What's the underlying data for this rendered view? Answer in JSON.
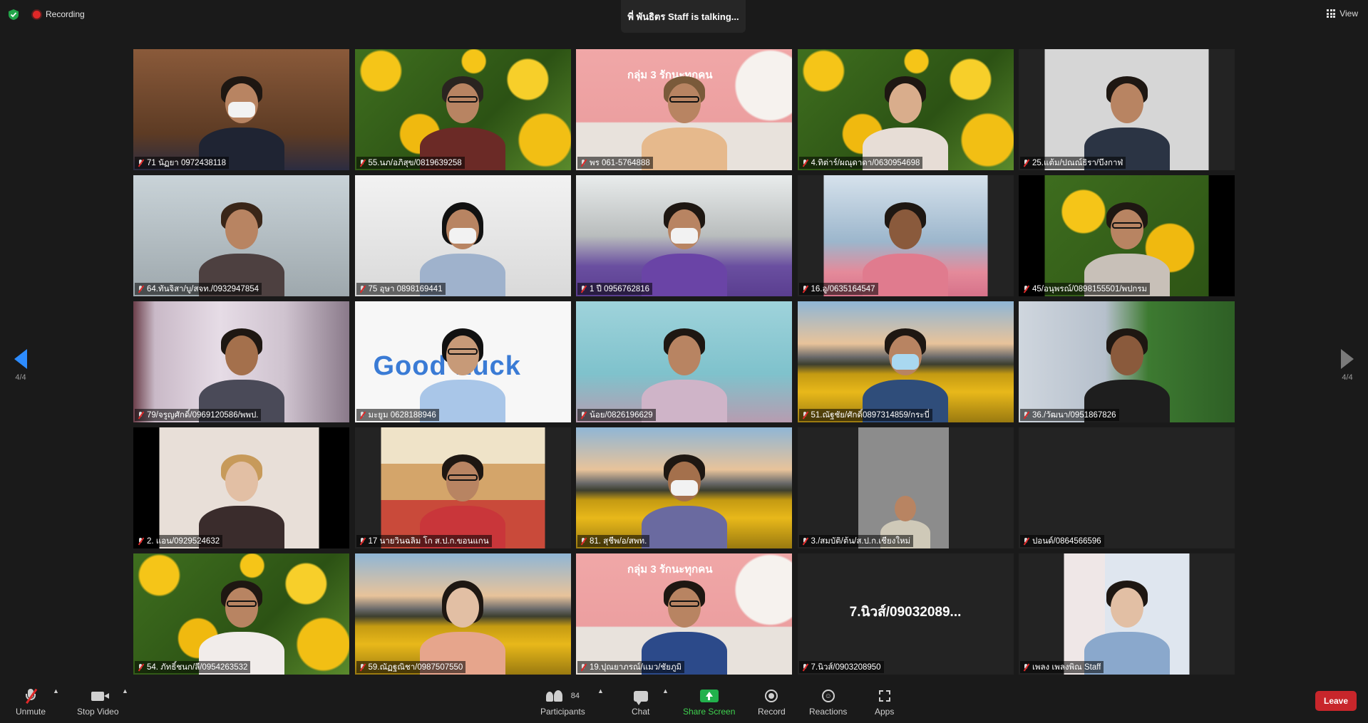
{
  "topbar": {
    "recording_label": "Recording",
    "talking_banner": "พี่ พันธิตร Staff is talking...",
    "view_label": "View"
  },
  "pager": {
    "page": "4/4"
  },
  "tiles": [
    "71 นัฏยา 0972438118",
    "55.นภ/อภิสุข/0819639258",
    "พร 061-5764888",
    "4.ทิต่าร์/ผณุดาดา/0630954698",
    "25.แต้ม/ปณณ์ธิรา/บึงกาฬ",
    "64.ทันจิสา/บู/สจท./0932947854",
    "75 อุษา 0898169441",
    "1 ปี 0956762816",
    "16.อู/0635164547",
    "45/อนุพรณ์/0898155501/พปกรม",
    "79/จรูญศักดิ์/0969120586/พพป.",
    "มะยูม 0628188946",
    "น้อย/0826196629",
    "51.ณัฐชัย/ศักดิ์0897314859/กระบี่",
    "36./วัฒนา/0951867826",
    "2. แอน/0929524632",
    "17 นายวินฉลิม โก ส.ป.ก.ขอนแกน",
    "81. สุชีพ/อ/สพท.",
    "3./สมบัติ/ต้น/ส.ป.ก.เชียงใหม่",
    "ปอนด์/0864566596",
    "54. ภัทธิ์ชนก/ลี/0954263532",
    "59.ณัฏฐณิชา/0987507550",
    "19.ปุณยาภรณ์/แมว/ชัยภูมิ",
    "7.นิวส์/0903208950",
    "เพลง เพลงพิณ Staff"
  ],
  "video_off_name": "7.นิวส์/09032089...",
  "background_texts": {
    "group_banner_1": "กลุ่ม 3 รักนะทุกคน",
    "group_banner_2": "กลุ่ม 3 รักนะทุกคน",
    "good_luck": "Good Luck"
  },
  "controls": {
    "unmute": "Unmute",
    "stop_video": "Stop Video",
    "participants": "Participants",
    "participant_count": "84",
    "chat": "Chat",
    "share_screen": "Share Screen",
    "record": "Record",
    "reactions": "Reactions",
    "apps": "Apps",
    "leave": "Leave"
  },
  "colors": {
    "accent_blue": "#2d8cff",
    "share_green": "#22b14c",
    "leave_red": "#c8262b",
    "mute_red": "#e02828"
  }
}
